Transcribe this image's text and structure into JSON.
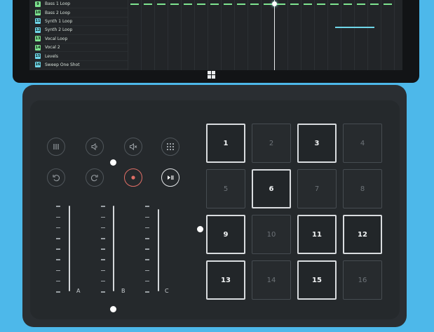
{
  "tracks": [
    {
      "num": "9",
      "name": "Bass 1 Loop",
      "color": "#7de38f"
    },
    {
      "num": "10",
      "name": "Bass 2 Loop",
      "color": "#7de38f"
    },
    {
      "num": "11",
      "name": "Synth 1 Loop",
      "color": "#6fd6e8"
    },
    {
      "num": "12",
      "name": "Synth 2 Loop",
      "color": "#6fd6e8"
    },
    {
      "num": "13",
      "name": "Vocal Loop",
      "color": "#7de38f"
    },
    {
      "num": "14",
      "name": "Vocal 2",
      "color": "#7de38f"
    },
    {
      "num": "15",
      "name": "Levels",
      "color": "#6fd6e8"
    },
    {
      "num": "16",
      "name": "Sweep One Shot",
      "color": "#6fd6e8"
    }
  ],
  "controls": {
    "row1": [
      {
        "icon": "pause-bars-icon"
      },
      {
        "icon": "speaker-icon"
      },
      {
        "icon": "mute-icon"
      },
      {
        "icon": "grid-icon"
      }
    ],
    "row2": [
      {
        "icon": "undo-icon"
      },
      {
        "icon": "redo-icon"
      },
      {
        "icon": "record-icon",
        "accent": "#e06e66"
      },
      {
        "icon": "play-pause-icon"
      }
    ]
  },
  "faders": {
    "labels": [
      "A",
      "B",
      "C"
    ],
    "levels": [
      0.72,
      0.72,
      0.69
    ]
  },
  "pads": [
    {
      "label": "1",
      "active": true
    },
    {
      "label": "2",
      "active": false
    },
    {
      "label": "3",
      "active": true
    },
    {
      "label": "4",
      "active": false
    },
    {
      "label": "5",
      "active": false
    },
    {
      "label": "6",
      "active": true
    },
    {
      "label": "7",
      "active": false
    },
    {
      "label": "8",
      "active": false
    },
    {
      "label": "9",
      "active": true
    },
    {
      "label": "10",
      "active": false
    },
    {
      "label": "11",
      "active": true
    },
    {
      "label": "12",
      "active": true
    },
    {
      "label": "13",
      "active": true
    },
    {
      "label": "14",
      "active": false
    },
    {
      "label": "15",
      "active": true
    },
    {
      "label": "16",
      "active": false
    }
  ],
  "colors": {
    "background": "#4db8ea",
    "green_track": "#7de38f",
    "cyan_track": "#6fd6e8",
    "record": "#e06e66"
  }
}
